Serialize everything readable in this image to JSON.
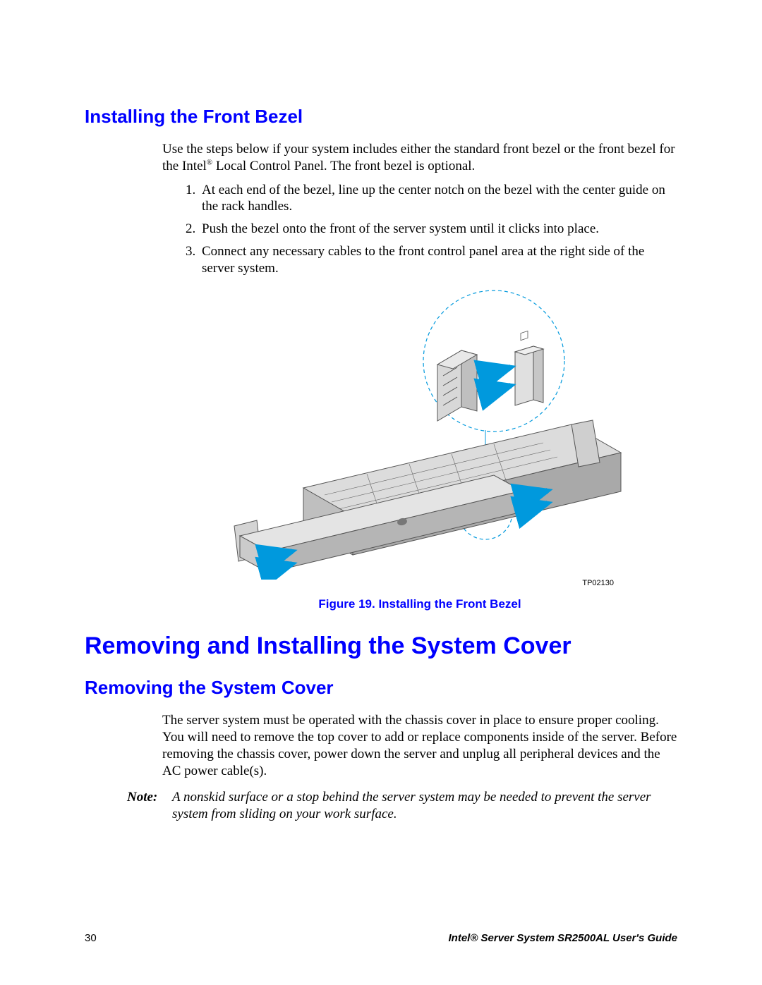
{
  "section1": {
    "heading": "Installing the Front Bezel",
    "intro_prefix": "Use the steps below if your system includes either the standard front bezel or the front bezel for the Intel",
    "intro_suffix": " Local Control Panel. The front bezel is optional.",
    "steps": [
      "At each end of the bezel, line up the center notch on the bezel with the center guide on the rack handles.",
      "Push the bezel onto the front of the server system until it clicks into place.",
      "Connect any necessary cables to the front control panel area at the right side of the server system."
    ]
  },
  "figure": {
    "id": "TP02130",
    "caption": "Figure 19. Installing the Front Bezel"
  },
  "section2": {
    "heading": "Removing and Installing the System Cover",
    "sub_heading": "Removing the System Cover",
    "intro": "The server system must be operated with the chassis cover in place to ensure proper cooling. You will need to remove the top cover to add or replace components inside of the server. Before removing the chassis cover, power down the server and unplug all peripheral devices and the AC power cable(s).",
    "note_label": "Note:",
    "note_text": "A nonskid surface or a stop behind the server system may be needed to prevent the server system from sliding on your work surface."
  },
  "footer": {
    "page_number": "30",
    "guide_title": "Intel® Server System SR2500AL User's Guide"
  }
}
